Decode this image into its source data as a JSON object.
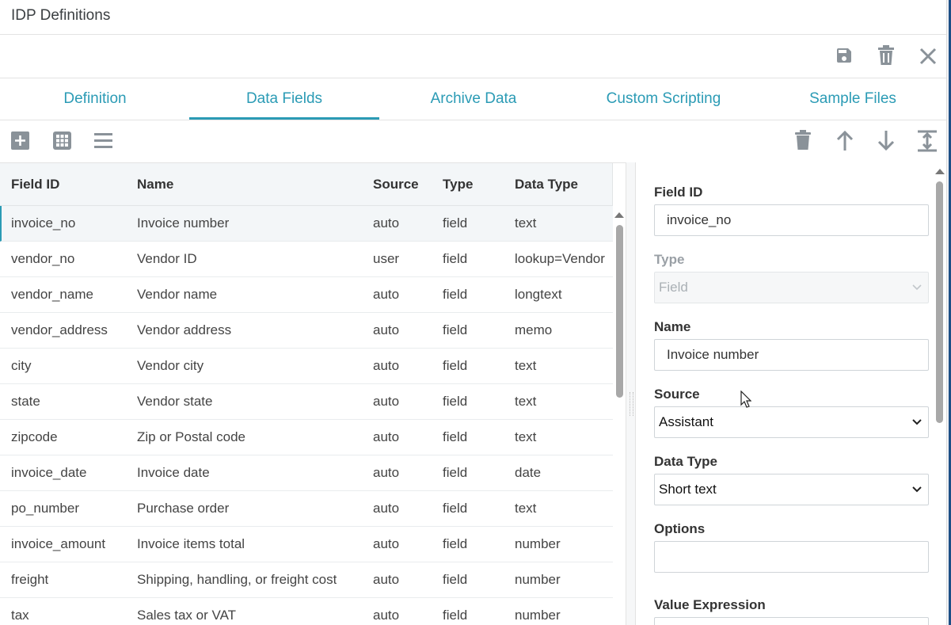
{
  "window": {
    "title": "IDP Definitions"
  },
  "actions": {
    "save_icon": "save-icon",
    "delete_icon": "trash-icon",
    "close_icon": "close-icon"
  },
  "tabs": [
    {
      "label": "Definition",
      "active": false
    },
    {
      "label": "Data Fields",
      "active": true
    },
    {
      "label": "Archive Data",
      "active": false
    },
    {
      "label": "Custom Scripting",
      "active": false
    },
    {
      "label": "Sample Files",
      "active": false
    }
  ],
  "toolbar": {
    "left_icons": [
      "add-icon",
      "grid-icon",
      "list-icon"
    ],
    "right_icons": [
      "trash-icon",
      "arrow-up-icon",
      "arrow-down-icon",
      "fit-height-icon"
    ]
  },
  "grid": {
    "columns": [
      "Field ID",
      "Name",
      "Source",
      "Type",
      "Data Type"
    ],
    "rows": [
      [
        "invoice_no",
        "Invoice number",
        "auto",
        "field",
        "text"
      ],
      [
        "vendor_no",
        "Vendor ID",
        "user",
        "field",
        "lookup=Vendor"
      ],
      [
        "vendor_name",
        "Vendor name",
        "auto",
        "field",
        "longtext"
      ],
      [
        "vendor_address",
        "Vendor address",
        "auto",
        "field",
        "memo"
      ],
      [
        "city",
        "Vendor city",
        "auto",
        "field",
        "text"
      ],
      [
        "state",
        "Vendor state",
        "auto",
        "field",
        "text"
      ],
      [
        "zipcode",
        "Zip or Postal code",
        "auto",
        "field",
        "text"
      ],
      [
        "invoice_date",
        "Invoice date",
        "auto",
        "field",
        "date"
      ],
      [
        "po_number",
        "Purchase order",
        "auto",
        "field",
        "text"
      ],
      [
        "invoice_amount",
        "Invoice items total",
        "auto",
        "field",
        "number"
      ],
      [
        "freight",
        "Shipping, handling, or freight cost",
        "auto",
        "field",
        "number"
      ],
      [
        "tax",
        "Sales tax or VAT",
        "auto",
        "field",
        "number"
      ]
    ],
    "selected_row": 0
  },
  "detail": {
    "field_id_label": "Field ID",
    "field_id_value": "invoice_no",
    "type_label": "Type",
    "type_value": "Field",
    "name_label": "Name",
    "name_value": "Invoice number",
    "source_label": "Source",
    "source_value": "Assistant",
    "data_type_label": "Data Type",
    "data_type_value": "Short text",
    "options_label": "Options",
    "options_value": "",
    "value_expression_label": "Value Expression"
  },
  "colors": {
    "accent": "#2b9bb5",
    "icon": "#8a9299",
    "header_bg": "#f3f6f8"
  }
}
